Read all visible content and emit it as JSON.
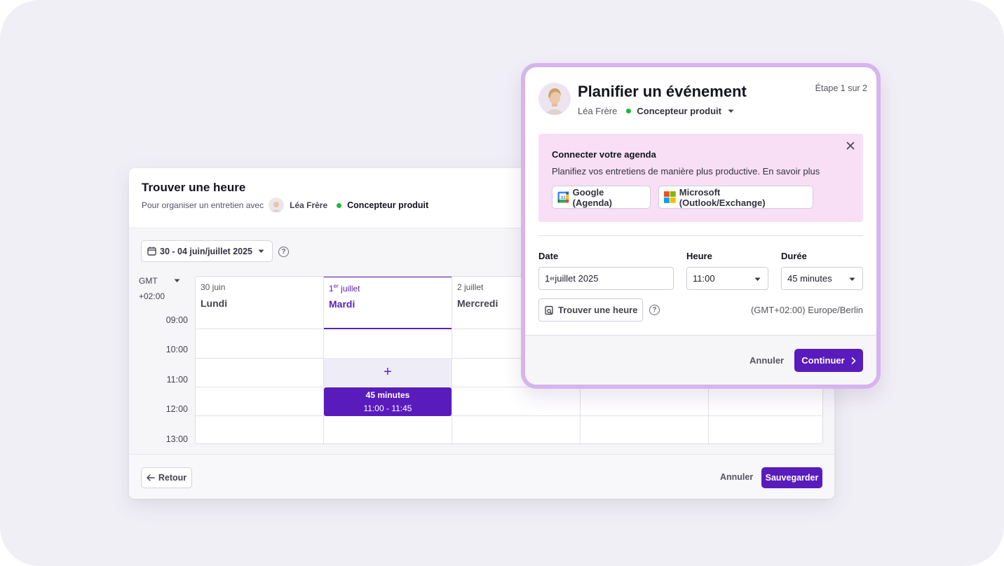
{
  "finder": {
    "title": "Trouver une heure",
    "subtitle_prefix": "Pour organiser un entretien avec",
    "candidate_name": "Léa Frère",
    "role": "Concepteur produit",
    "date_range": "30 - 04 juin/juillet 2025",
    "timezone_line1": "GMT",
    "timezone_line2": "+02:00",
    "hours": [
      "09:00",
      "10:00",
      "11:00",
      "12:00",
      "13:00"
    ],
    "days": [
      {
        "date": "30 juin",
        "weekday": "Lundi",
        "active": false
      },
      {
        "date_num": "1",
        "date_sup": "er",
        "date_rest": " juillet",
        "weekday": "Mardi",
        "active": true
      },
      {
        "date": "2 juillet",
        "weekday": "Mercredi",
        "active": false
      },
      {
        "date": "",
        "weekday": "",
        "active": false
      },
      {
        "date": "",
        "weekday": "",
        "active": false
      }
    ],
    "add_slot_symbol": "+",
    "event": {
      "duration": "45 minutes",
      "time": "11:00 - 11:45"
    },
    "back_label": "Retour",
    "cancel_label": "Annuler",
    "save_label": "Sauvegarder"
  },
  "modal": {
    "title": "Planifier un événement",
    "step": "Étape 1 sur 2",
    "candidate_name": "Léa Frère",
    "role": "Concepteur produit",
    "banner": {
      "title": "Connecter votre agenda",
      "description": "Planifiez vos entretiens de manière plus productive. En savoir plus",
      "google_label": "Google (Agenda)",
      "microsoft_label": "Microsoft (Outlook/Exchange)"
    },
    "date_label": "Date",
    "date_num": "1",
    "date_sup": "er",
    "date_rest": " juillet 2025",
    "time_label": "Heure",
    "time_value": "11:00",
    "duration_label": "Durée",
    "duration_value": "45 minutes",
    "find_time_label": "Trouver une heure",
    "timezone": "(GMT+02:00) Europe/Berlin",
    "cancel_label": "Annuler",
    "continue_label": "Continuer"
  },
  "colors": {
    "primary": "#5a1bbd",
    "status_green": "#1eb83c",
    "banner_bg": "#f8dff5",
    "modal_ring": "#d6b4ee",
    "stage_bg": "#f1eff6"
  },
  "icons": [
    "calendar-icon",
    "chevron-down-icon",
    "help-icon",
    "arrow-left-icon",
    "close-icon",
    "google-calendar-icon",
    "microsoft-icon",
    "search-calendar-icon",
    "chevron-right-icon",
    "plus-icon"
  ]
}
